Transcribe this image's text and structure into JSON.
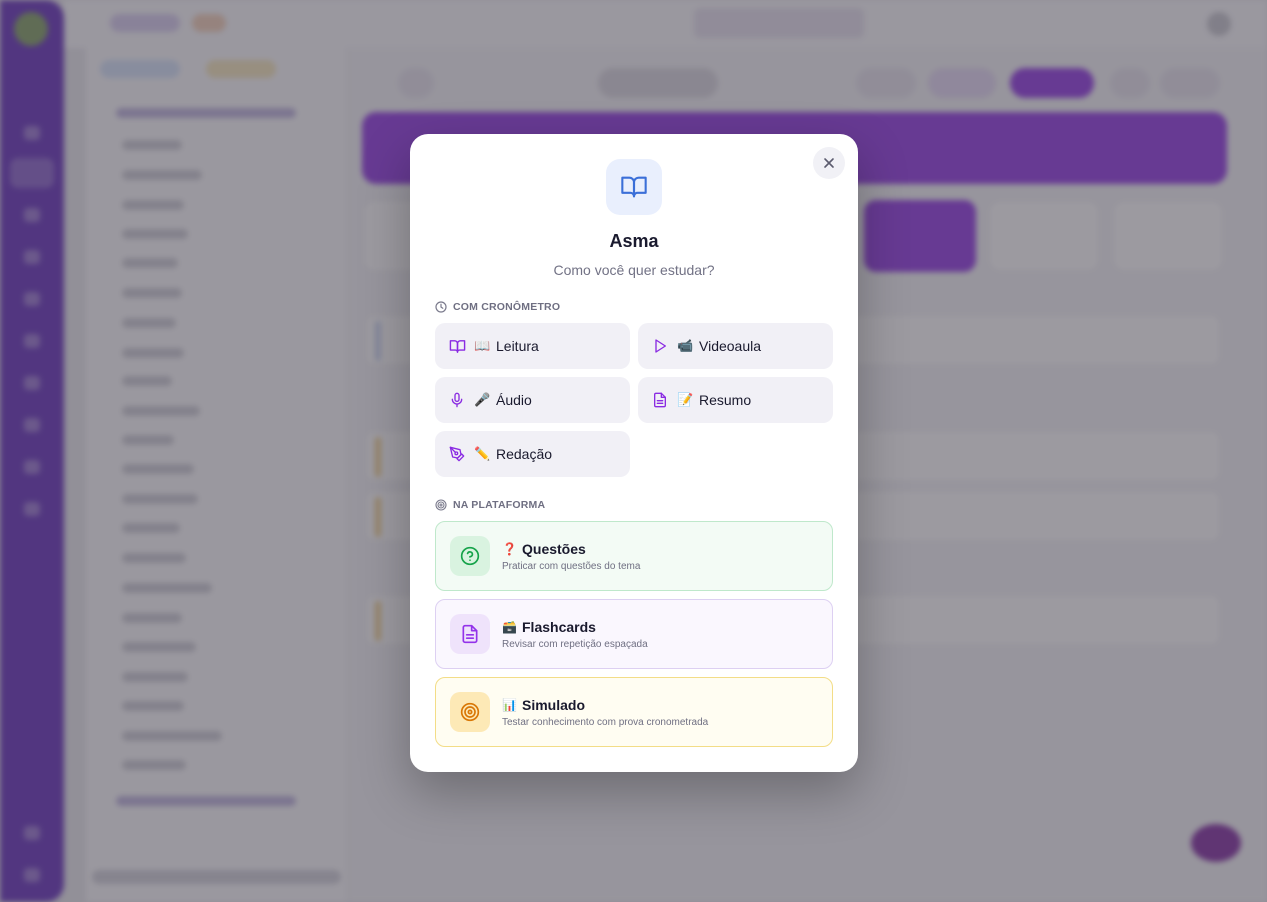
{
  "modal": {
    "title": "Asma",
    "subtitle": "Como você quer estudar?",
    "close_icon": "x-icon",
    "hero_icon": "open-book-icon",
    "timed_section": {
      "label": "COM CRONÔMETRO",
      "icon": "clock-icon",
      "options": [
        {
          "icon": "book-icon",
          "emoji": "📖",
          "label": "Leitura"
        },
        {
          "icon": "play-icon",
          "emoji": "📹",
          "label": "Videoaula"
        },
        {
          "icon": "microphone-icon",
          "emoji": "🎤",
          "label": "Áudio"
        },
        {
          "icon": "document-icon",
          "emoji": "📝",
          "label": "Resumo"
        },
        {
          "icon": "pen-tool-icon",
          "emoji": "✏️",
          "label": "Redação"
        }
      ]
    },
    "platform_section": {
      "label": "NA PLATAFORMA",
      "icon": "target-icon",
      "options": [
        {
          "icon": "question-circle-icon",
          "emoji": "❓",
          "label": "Questões",
          "description": "Praticar com questões do tema",
          "color": "#16a34a"
        },
        {
          "icon": "document-icon",
          "emoji": "🗃️",
          "label": "Flashcards",
          "description": "Revisar com repetição espaçada",
          "color": "#9333ea"
        },
        {
          "icon": "target-icon",
          "emoji": "📊",
          "label": "Simulado",
          "description": "Testar conhecimento com prova cronometrada",
          "color": "#d97706"
        }
      ]
    }
  },
  "colors": {
    "accent": "#8a2be2",
    "sidebar": "#5b23b8",
    "hero_icon": "#3b6fd8"
  }
}
